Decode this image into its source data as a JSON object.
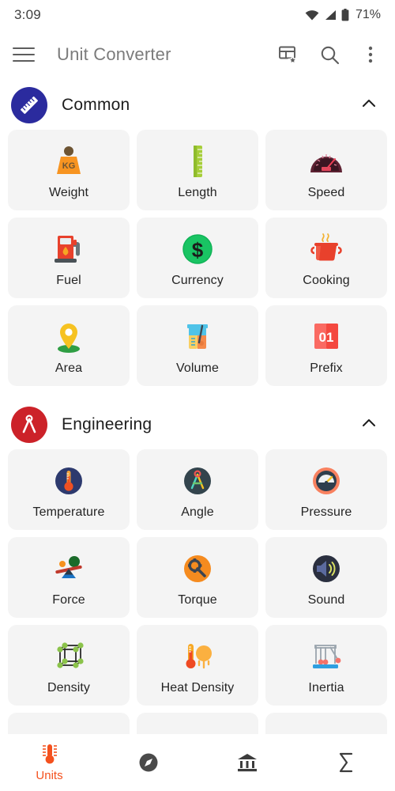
{
  "statusbar": {
    "time": "3:09",
    "battery": "71%",
    "icons": [
      "wifi-icon",
      "signal-icon",
      "battery-icon"
    ]
  },
  "appbar": {
    "menu_icon": "hamburger-menu-icon",
    "title": "Unit Converter",
    "actions": [
      {
        "name": "favorites-grid-icon",
        "label": "grid-star-icon"
      },
      {
        "name": "search-icon",
        "label": "search-icon"
      },
      {
        "name": "overflow-menu-icon",
        "label": "more-vert-icon"
      }
    ]
  },
  "sections": [
    {
      "title": "Common",
      "badge_icon": "ruler-icon",
      "badge_color": "#2b2b9e",
      "expanded": true,
      "chevron": "chevron-up-icon",
      "items": [
        {
          "label": "Weight",
          "icon": "weight-kg-icon"
        },
        {
          "label": "Length",
          "icon": "ruler-green-icon"
        },
        {
          "label": "Speed",
          "icon": "speedometer-icon"
        },
        {
          "label": "Fuel",
          "icon": "fuel-pump-icon"
        },
        {
          "label": "Currency",
          "icon": "dollar-coin-icon"
        },
        {
          "label": "Cooking",
          "icon": "cooking-pot-icon"
        },
        {
          "label": "Area",
          "icon": "map-pin-icon"
        },
        {
          "label": "Volume",
          "icon": "beaker-icon"
        },
        {
          "label": "Prefix",
          "icon": "flip-counter-01-icon"
        }
      ]
    },
    {
      "title": "Engineering",
      "badge_icon": "compass-divider-icon",
      "badge_color": "#cc2229",
      "expanded": true,
      "chevron": "chevron-up-icon",
      "items": [
        {
          "label": "Temperature",
          "icon": "thermometer-circle-icon"
        },
        {
          "label": "Angle",
          "icon": "drafting-compass-icon"
        },
        {
          "label": "Pressure",
          "icon": "pressure-gauge-icon"
        },
        {
          "label": "Force",
          "icon": "seesaw-balance-icon"
        },
        {
          "label": "Torque",
          "icon": "wrench-gear-icon"
        },
        {
          "label": "Sound",
          "icon": "speaker-icon"
        },
        {
          "label": "Density",
          "icon": "molecule-cube-icon"
        },
        {
          "label": "Heat Density",
          "icon": "thermometer-sun-icon"
        },
        {
          "label": "Inertia",
          "icon": "newtons-cradle-icon"
        }
      ]
    }
  ],
  "bottom_nav": {
    "active_index": 0,
    "items": [
      {
        "label": "Units",
        "icon": "thermometer-icon",
        "active": true
      },
      {
        "label": "",
        "icon": "compass-icon",
        "active": false
      },
      {
        "label": "",
        "icon": "bank-icon",
        "active": false
      },
      {
        "label": "",
        "icon": "sigma-icon",
        "active": false
      }
    ]
  },
  "colors": {
    "accent": "#f4511e",
    "card_bg": "#f4f4f4",
    "text": "#242424",
    "title_text": "#7b7b7b"
  }
}
